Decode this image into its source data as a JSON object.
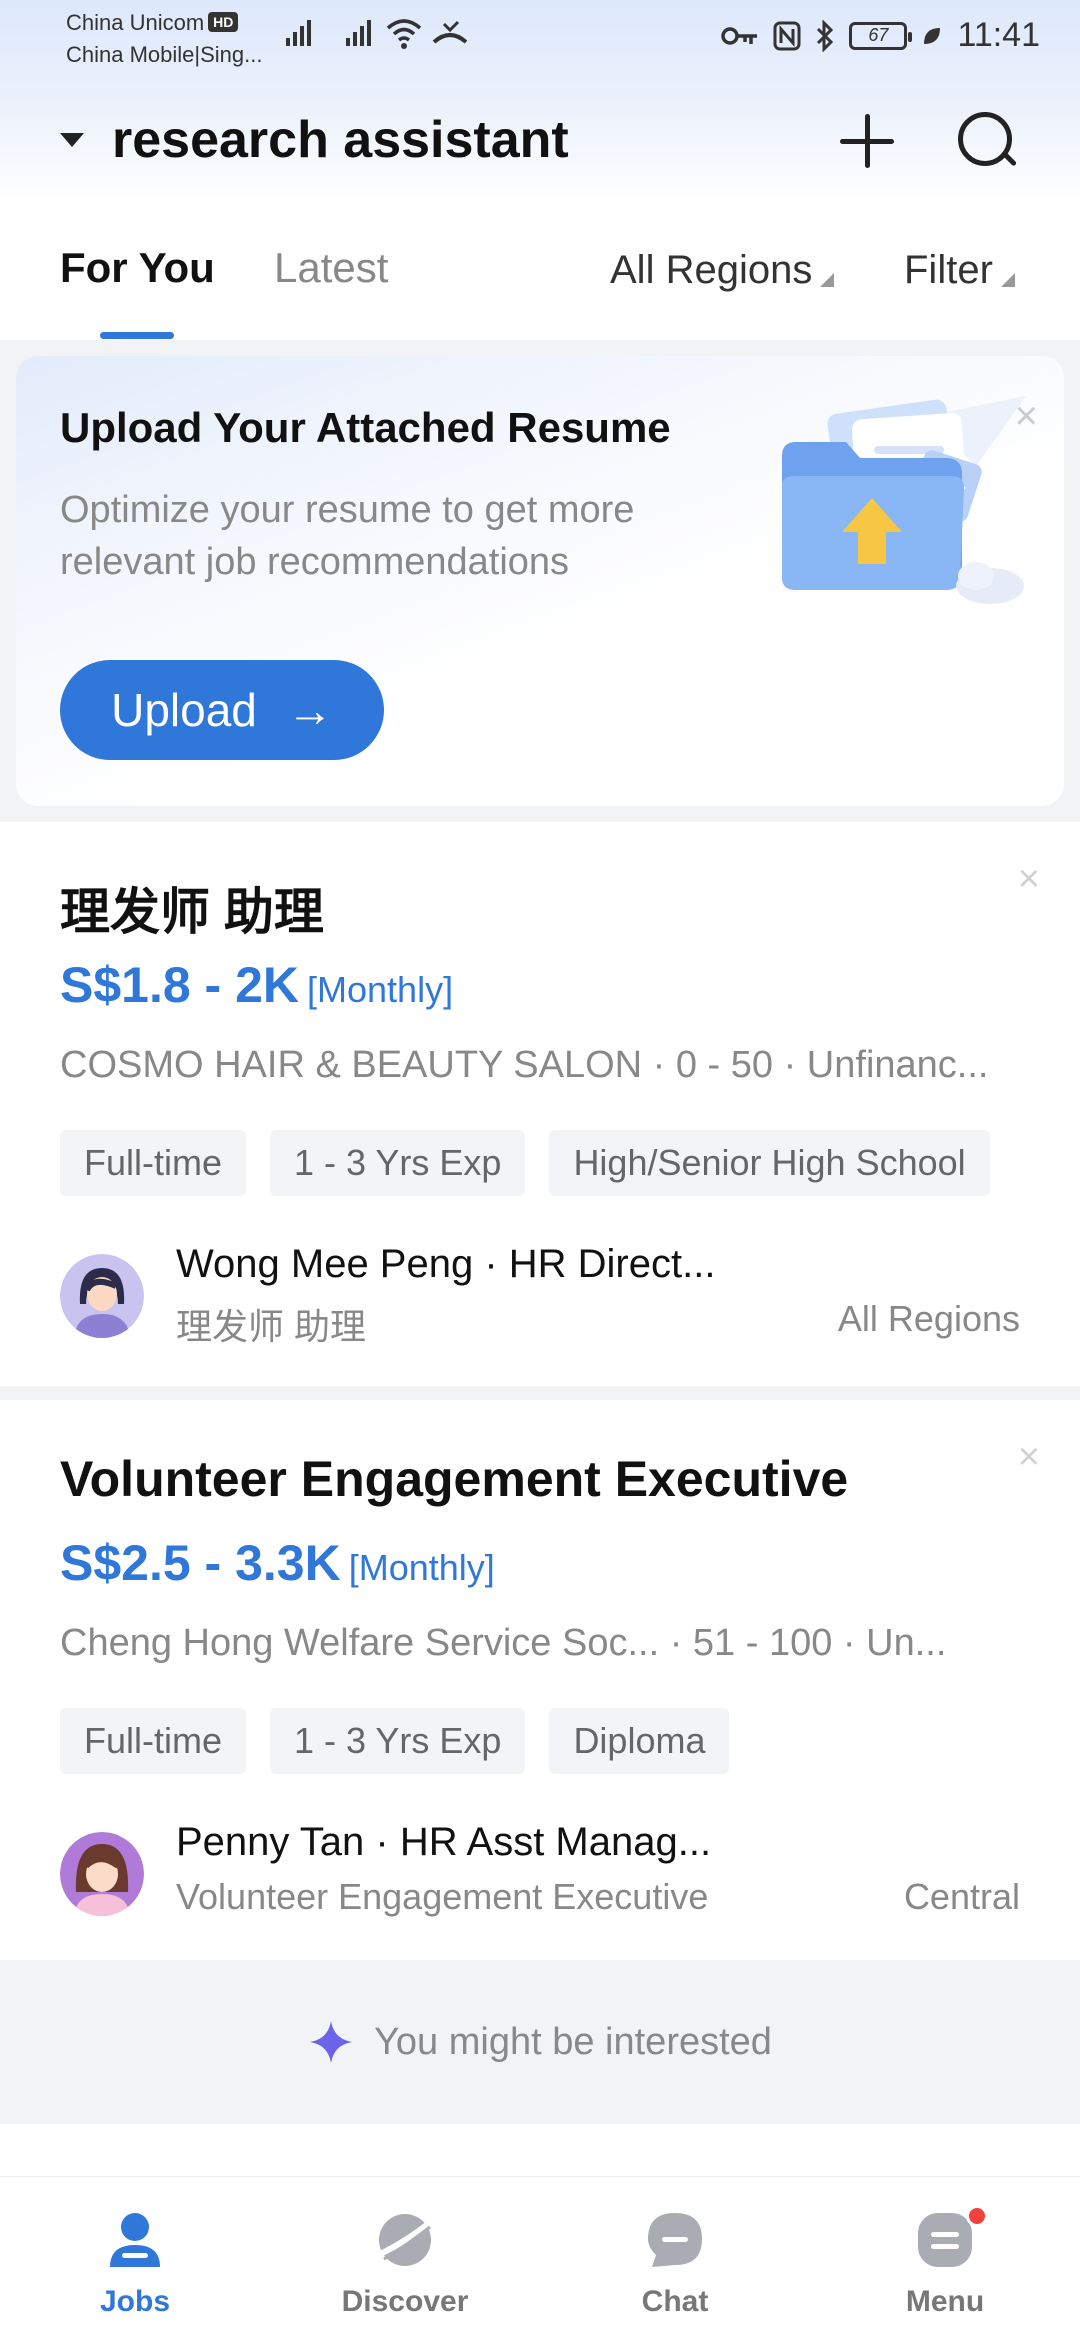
{
  "status_bar": {
    "carrier1": "China Unicom",
    "carrier1_badge": "HD",
    "carrier2": "China Mobile|Sing...",
    "battery": "67",
    "time": "11:41"
  },
  "search": {
    "query": "research assistant"
  },
  "tabs": {
    "for_you": "For You",
    "latest": "Latest",
    "regions": "All Regions",
    "filter": "Filter"
  },
  "upload_card": {
    "title": "Upload Your Attached Resume",
    "subtitle": "Optimize your resume to get more relevant job recommendations",
    "button": "Upload",
    "arrow": "→",
    "close": "×"
  },
  "jobs": [
    {
      "title": "理发师 助理",
      "salary": "S$1.8 - 2K",
      "period": "[Monthly]",
      "company": "COSMO HAIR & BEAUTY SALON · 0 - 50 · Unfinanc...",
      "tags": [
        "Full-time",
        "1 - 3 Yrs Exp",
        "High/Senior High School"
      ],
      "recruiter": "Wong Mee Peng · HR Direct...",
      "recruiter_job": "理发师 助理",
      "region": "All Regions",
      "close": "×"
    },
    {
      "title": "Volunteer Engagement Executive",
      "salary": "S$2.5 - 3.3K",
      "period": "[Monthly]",
      "company": "Cheng Hong Welfare Service Soc... · 51 - 100 · Un...",
      "tags": [
        "Full-time",
        "1 - 3 Yrs Exp",
        "Diploma"
      ],
      "recruiter": "Penny Tan · HR Asst Manag...",
      "recruiter_job": "Volunteer Engagement Executive",
      "region": "Central",
      "close": "×"
    }
  ],
  "interest": {
    "text": "You might be interested"
  },
  "nav": {
    "jobs": "Jobs",
    "discover": "Discover",
    "chat": "Chat",
    "menu": "Menu"
  },
  "colors": {
    "accent": "#2f77d8",
    "badge": "#f0413c"
  }
}
